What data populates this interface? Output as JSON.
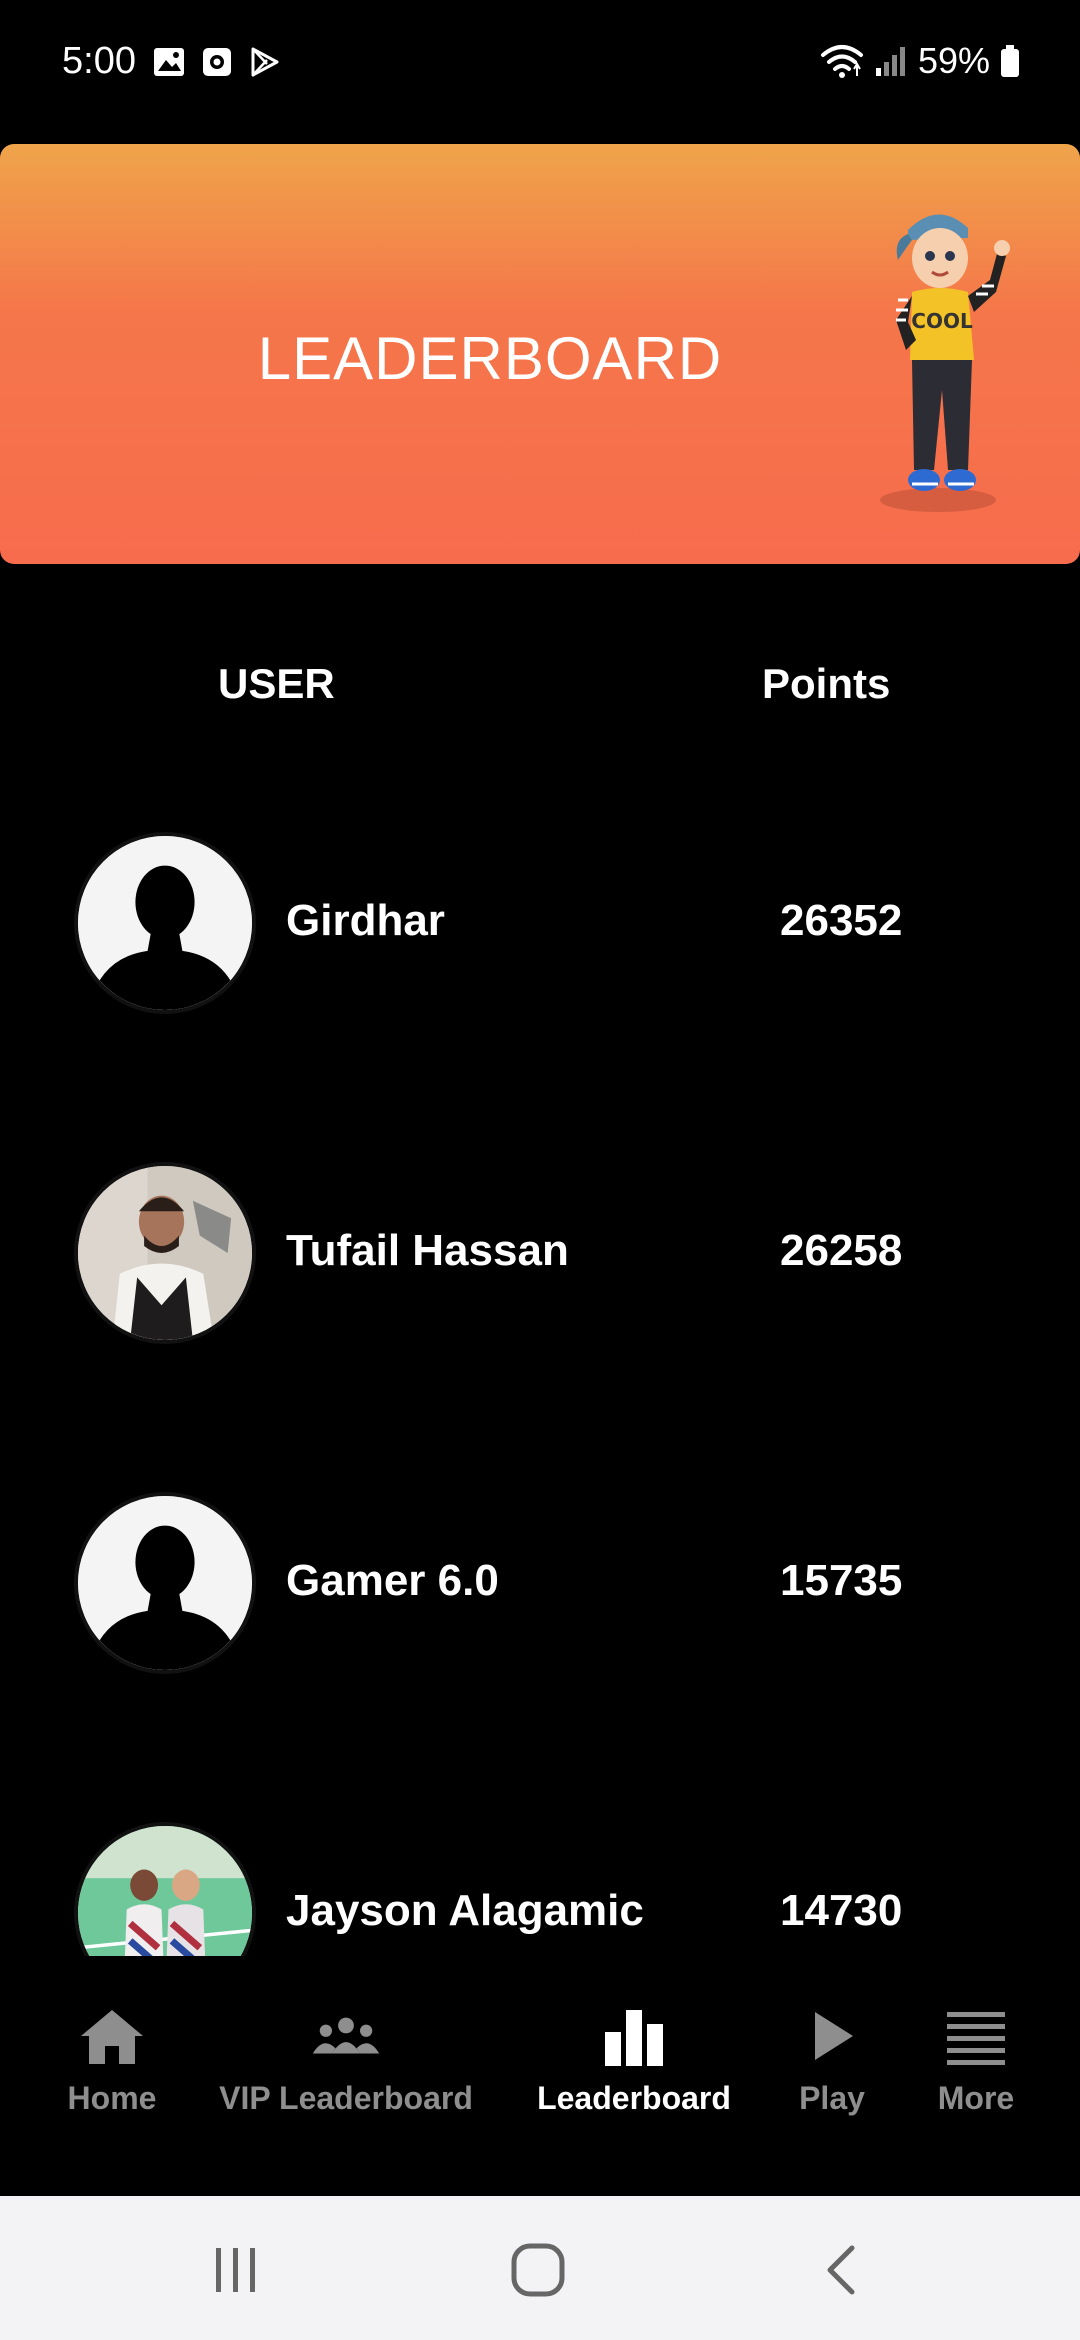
{
  "status_bar": {
    "time": "5:00",
    "battery": "59%",
    "left_icons": [
      "gallery-icon",
      "screen-record-icon",
      "play-store-icon"
    ],
    "right_icons": [
      "wifi-icon",
      "signal-icon",
      "battery-icon"
    ]
  },
  "banner": {
    "title": "LEADERBOARD",
    "gradient_top": "#efa44a",
    "gradient_bottom": "#f76c4d"
  },
  "table": {
    "col_user": "USER",
    "col_points": "Points",
    "rows": [
      {
        "name": "Girdhar",
        "points": "26352",
        "avatar": "default-avatar"
      },
      {
        "name": "Tufail Hassan",
        "points": "26258",
        "avatar": "photo-avatar"
      },
      {
        "name": "Gamer 6.0",
        "points": "15735",
        "avatar": "default-avatar"
      },
      {
        "name": "Jayson Alagamic",
        "points": "14730",
        "avatar": "photo-avatar"
      }
    ]
  },
  "bottom_nav": {
    "items": [
      {
        "label": "Home",
        "icon": "home-icon",
        "active": false
      },
      {
        "label": "VIP Leaderboard",
        "icon": "group-icon",
        "active": false
      },
      {
        "label": "Leaderboard",
        "icon": "bar-chart-icon",
        "active": true
      },
      {
        "label": "Play",
        "icon": "play-icon",
        "active": false
      },
      {
        "label": "More",
        "icon": "menu-icon",
        "active": false
      }
    ],
    "active_color": "#ffffff",
    "inactive_color": "#8e8e8e"
  },
  "system_nav": {
    "buttons": [
      "recent-apps-icon",
      "home-circle-icon",
      "back-icon"
    ]
  }
}
